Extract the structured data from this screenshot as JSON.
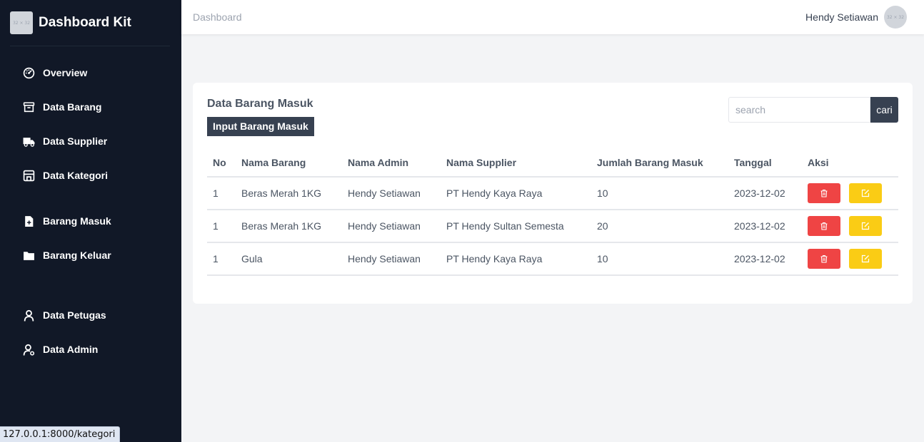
{
  "brand": {
    "title": "Dashboard Kit",
    "logo_text": "32 × 32"
  },
  "sidebar": {
    "items": [
      {
        "label": "Overview",
        "icon": "gauge-icon"
      },
      {
        "label": "Data Barang",
        "icon": "archive-box-icon"
      },
      {
        "label": "Data Supplier",
        "icon": "truck-icon"
      },
      {
        "label": "Data Kategori",
        "icon": "store-icon"
      },
      {
        "label": "Barang Masuk",
        "icon": "file-plus-icon"
      },
      {
        "label": "Barang Keluar",
        "icon": "folder-icon"
      },
      {
        "label": "Data Petugas",
        "icon": "user-icon"
      },
      {
        "label": "Data Admin",
        "icon": "user-cog-icon"
      }
    ]
  },
  "header": {
    "breadcrumb": "Dashboard",
    "user_name": "Hendy Setiawan",
    "avatar_text": "32 × 32"
  },
  "main": {
    "title": "Data Barang Masuk",
    "input_button": "Input Barang Masuk",
    "search": {
      "placeholder": "search",
      "value": "",
      "button": "cari"
    },
    "table": {
      "columns": [
        "No",
        "Nama Barang",
        "Nama Admin",
        "Nama Supplier",
        "Jumlah Barang Masuk",
        "Tanggal",
        "Aksi"
      ],
      "rows": [
        [
          "1",
          "Beras Merah 1KG",
          "Hendy Setiawan",
          "PT Hendy Kaya Raya",
          "10",
          "2023-12-02"
        ],
        [
          "1",
          "Beras Merah 1KG",
          "Hendy Setiawan",
          "PT Hendy Sultan Semesta",
          "20",
          "2023-12-02"
        ],
        [
          "1",
          "Gula",
          "Hendy Setiawan",
          "PT Hendy Kaya Raya",
          "10",
          "2023-12-02"
        ]
      ],
      "actions": {
        "delete_icon": "trash-icon",
        "edit_icon": "edit-icon"
      }
    }
  },
  "status_bar": {
    "url": "127.0.0.1:8000/kategori"
  },
  "colors": {
    "sidebar_bg": "#111827",
    "primary": "#374151",
    "delete": "#ef4444",
    "edit": "#facc15",
    "page_bg": "#f3f4f6"
  }
}
